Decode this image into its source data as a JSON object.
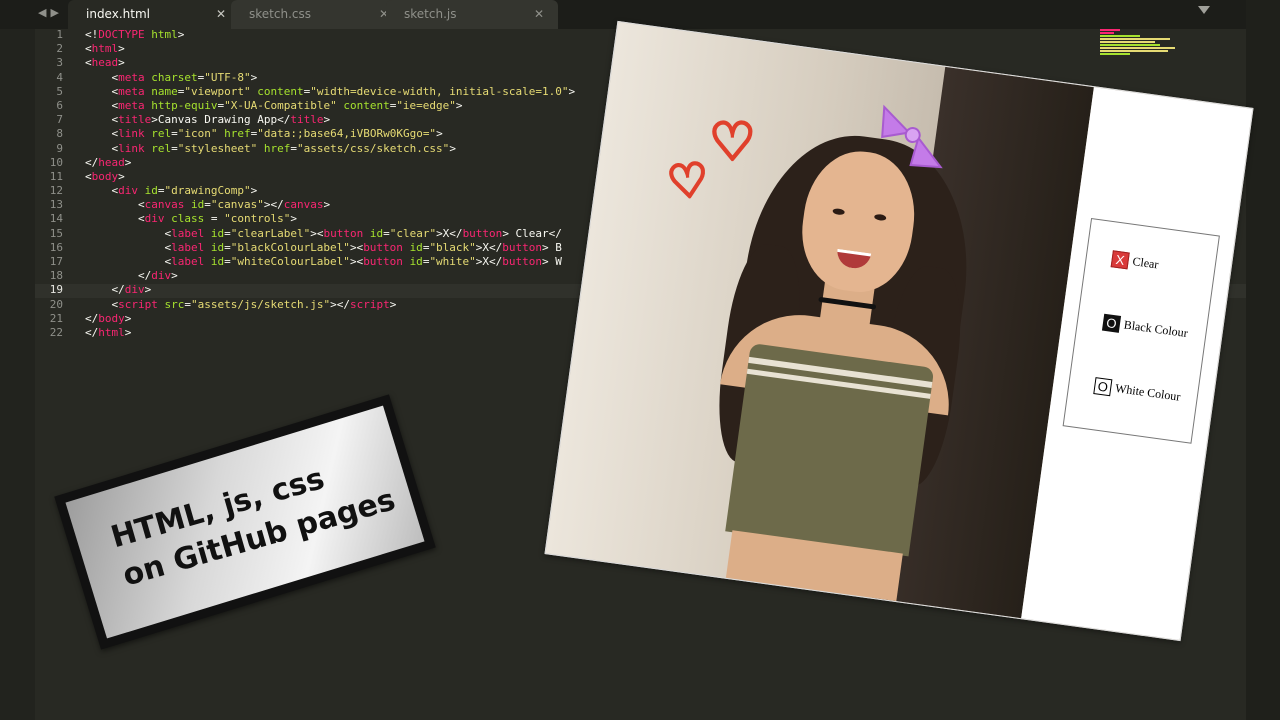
{
  "tabs": [
    {
      "label": "index.html",
      "active": true
    },
    {
      "label": "sketch.css",
      "active": false
    },
    {
      "label": "sketch.js",
      "active": false
    }
  ],
  "editor": {
    "current_line": 19,
    "line_numbers": [
      "1",
      "2",
      "3",
      "4",
      "5",
      "6",
      "7",
      "8",
      "9",
      "10",
      "11",
      "12",
      "13",
      "14",
      "15",
      "16",
      "17",
      "18",
      "19",
      "20",
      "21",
      "22"
    ],
    "lines": [
      {
        "parts": [
          {
            "t": "<!",
            "c": "p"
          },
          {
            "t": "DOCTYPE",
            "c": "tg"
          },
          {
            "t": " ",
            "c": "p"
          },
          {
            "t": "html",
            "c": "at"
          },
          {
            "t": ">",
            "c": "p"
          }
        ]
      },
      {
        "parts": [
          {
            "t": "<",
            "c": "p"
          },
          {
            "t": "html",
            "c": "tg"
          },
          {
            "t": ">",
            "c": "p"
          }
        ]
      },
      {
        "parts": [
          {
            "t": "<",
            "c": "p"
          },
          {
            "t": "head",
            "c": "tg"
          },
          {
            "t": ">",
            "c": "p"
          }
        ]
      },
      {
        "parts": [
          {
            "t": "    <",
            "c": "p"
          },
          {
            "t": "meta",
            "c": "tg"
          },
          {
            "t": " ",
            "c": "p"
          },
          {
            "t": "charset",
            "c": "at"
          },
          {
            "t": "=",
            "c": "p"
          },
          {
            "t": "\"UTF-8\"",
            "c": "st"
          },
          {
            "t": ">",
            "c": "p"
          }
        ]
      },
      {
        "parts": [
          {
            "t": "    <",
            "c": "p"
          },
          {
            "t": "meta",
            "c": "tg"
          },
          {
            "t": " ",
            "c": "p"
          },
          {
            "t": "name",
            "c": "at"
          },
          {
            "t": "=",
            "c": "p"
          },
          {
            "t": "\"viewport\"",
            "c": "st"
          },
          {
            "t": " ",
            "c": "p"
          },
          {
            "t": "content",
            "c": "at"
          },
          {
            "t": "=",
            "c": "p"
          },
          {
            "t": "\"width=device-width, initial-scale=1.0\"",
            "c": "st"
          },
          {
            "t": ">",
            "c": "p"
          }
        ]
      },
      {
        "parts": [
          {
            "t": "    <",
            "c": "p"
          },
          {
            "t": "meta",
            "c": "tg"
          },
          {
            "t": " ",
            "c": "p"
          },
          {
            "t": "http-equiv",
            "c": "at"
          },
          {
            "t": "=",
            "c": "p"
          },
          {
            "t": "\"X-UA-Compatible\"",
            "c": "st"
          },
          {
            "t": " ",
            "c": "p"
          },
          {
            "t": "content",
            "c": "at"
          },
          {
            "t": "=",
            "c": "p"
          },
          {
            "t": "\"ie=edge\"",
            "c": "st"
          },
          {
            "t": ">",
            "c": "p"
          }
        ]
      },
      {
        "parts": [
          {
            "t": "    <",
            "c": "p"
          },
          {
            "t": "title",
            "c": "tg"
          },
          {
            "t": ">Canvas Drawing App</",
            "c": "p"
          },
          {
            "t": "title",
            "c": "tg"
          },
          {
            "t": ">",
            "c": "p"
          }
        ]
      },
      {
        "parts": [
          {
            "t": "    <",
            "c": "p"
          },
          {
            "t": "link",
            "c": "tg"
          },
          {
            "t": " ",
            "c": "p"
          },
          {
            "t": "rel",
            "c": "at"
          },
          {
            "t": "=",
            "c": "p"
          },
          {
            "t": "\"icon\"",
            "c": "st"
          },
          {
            "t": " ",
            "c": "p"
          },
          {
            "t": "href",
            "c": "at"
          },
          {
            "t": "=",
            "c": "p"
          },
          {
            "t": "\"data:;base64,iVBORw0KGgo=\"",
            "c": "st"
          },
          {
            "t": ">",
            "c": "p"
          }
        ]
      },
      {
        "parts": [
          {
            "t": "    <",
            "c": "p"
          },
          {
            "t": "link",
            "c": "tg"
          },
          {
            "t": " ",
            "c": "p"
          },
          {
            "t": "rel",
            "c": "at"
          },
          {
            "t": "=",
            "c": "p"
          },
          {
            "t": "\"stylesheet\"",
            "c": "st"
          },
          {
            "t": " ",
            "c": "p"
          },
          {
            "t": "href",
            "c": "at"
          },
          {
            "t": "=",
            "c": "p"
          },
          {
            "t": "\"assets/css/sketch.css\"",
            "c": "st"
          },
          {
            "t": ">",
            "c": "p"
          }
        ]
      },
      {
        "parts": [
          {
            "t": "</",
            "c": "p"
          },
          {
            "t": "head",
            "c": "tg"
          },
          {
            "t": ">",
            "c": "p"
          }
        ]
      },
      {
        "parts": [
          {
            "t": "<",
            "c": "p"
          },
          {
            "t": "body",
            "c": "tg"
          },
          {
            "t": ">",
            "c": "p"
          }
        ]
      },
      {
        "parts": [
          {
            "t": "    <",
            "c": "p"
          },
          {
            "t": "div",
            "c": "tg"
          },
          {
            "t": " ",
            "c": "p"
          },
          {
            "t": "id",
            "c": "at"
          },
          {
            "t": "=",
            "c": "p"
          },
          {
            "t": "\"drawingComp\"",
            "c": "st"
          },
          {
            "t": ">",
            "c": "p"
          }
        ]
      },
      {
        "parts": [
          {
            "t": "        <",
            "c": "p"
          },
          {
            "t": "canvas",
            "c": "tg"
          },
          {
            "t": " ",
            "c": "p"
          },
          {
            "t": "id",
            "c": "at"
          },
          {
            "t": "=",
            "c": "p"
          },
          {
            "t": "\"canvas\"",
            "c": "st"
          },
          {
            "t": "></",
            "c": "p"
          },
          {
            "t": "canvas",
            "c": "tg"
          },
          {
            "t": ">",
            "c": "p"
          }
        ]
      },
      {
        "parts": [
          {
            "t": "        <",
            "c": "p"
          },
          {
            "t": "div",
            "c": "tg"
          },
          {
            "t": " ",
            "c": "p"
          },
          {
            "t": "class",
            "c": "at"
          },
          {
            "t": " = ",
            "c": "p"
          },
          {
            "t": "\"controls\"",
            "c": "st"
          },
          {
            "t": ">",
            "c": "p"
          }
        ]
      },
      {
        "parts": [
          {
            "t": "            <",
            "c": "p"
          },
          {
            "t": "label",
            "c": "tg"
          },
          {
            "t": " ",
            "c": "p"
          },
          {
            "t": "id",
            "c": "at"
          },
          {
            "t": "=",
            "c": "p"
          },
          {
            "t": "\"clearLabel\"",
            "c": "st"
          },
          {
            "t": "><",
            "c": "p"
          },
          {
            "t": "button",
            "c": "tg"
          },
          {
            "t": " ",
            "c": "p"
          },
          {
            "t": "id",
            "c": "at"
          },
          {
            "t": "=",
            "c": "p"
          },
          {
            "t": "\"clear\"",
            "c": "st"
          },
          {
            "t": ">X</",
            "c": "p"
          },
          {
            "t": "button",
            "c": "tg"
          },
          {
            "t": "> Clear</",
            "c": "p"
          }
        ]
      },
      {
        "parts": [
          {
            "t": "            <",
            "c": "p"
          },
          {
            "t": "label",
            "c": "tg"
          },
          {
            "t": " ",
            "c": "p"
          },
          {
            "t": "id",
            "c": "at"
          },
          {
            "t": "=",
            "c": "p"
          },
          {
            "t": "\"blackColourLabel\"",
            "c": "st"
          },
          {
            "t": "><",
            "c": "p"
          },
          {
            "t": "button",
            "c": "tg"
          },
          {
            "t": " ",
            "c": "p"
          },
          {
            "t": "id",
            "c": "at"
          },
          {
            "t": "=",
            "c": "p"
          },
          {
            "t": "\"black\"",
            "c": "st"
          },
          {
            "t": ">X</",
            "c": "p"
          },
          {
            "t": "button",
            "c": "tg"
          },
          {
            "t": "> B",
            "c": "p"
          }
        ]
      },
      {
        "parts": [
          {
            "t": "            <",
            "c": "p"
          },
          {
            "t": "label",
            "c": "tg"
          },
          {
            "t": " ",
            "c": "p"
          },
          {
            "t": "id",
            "c": "at"
          },
          {
            "t": "=",
            "c": "p"
          },
          {
            "t": "\"whiteColourLabel\"",
            "c": "st"
          },
          {
            "t": "><",
            "c": "p"
          },
          {
            "t": "button",
            "c": "tg"
          },
          {
            "t": " ",
            "c": "p"
          },
          {
            "t": "id",
            "c": "at"
          },
          {
            "t": "=",
            "c": "p"
          },
          {
            "t": "\"white\"",
            "c": "st"
          },
          {
            "t": ">X</",
            "c": "p"
          },
          {
            "t": "button",
            "c": "tg"
          },
          {
            "t": "> W",
            "c": "p"
          }
        ]
      },
      {
        "parts": [
          {
            "t": "        </",
            "c": "p"
          },
          {
            "t": "div",
            "c": "tg"
          },
          {
            "t": ">",
            "c": "p"
          }
        ]
      },
      {
        "parts": [
          {
            "t": "    </",
            "c": "p"
          },
          {
            "t": "div",
            "c": "tg"
          },
          {
            "t": ">",
            "c": "p"
          }
        ]
      },
      {
        "parts": [
          {
            "t": "    <",
            "c": "p"
          },
          {
            "t": "script",
            "c": "tg"
          },
          {
            "t": " ",
            "c": "p"
          },
          {
            "t": "src",
            "c": "at"
          },
          {
            "t": "=",
            "c": "p"
          },
          {
            "t": "\"assets/js/sketch.js\"",
            "c": "st"
          },
          {
            "t": "></",
            "c": "p"
          },
          {
            "t": "script",
            "c": "tg"
          },
          {
            "t": ">",
            "c": "p"
          }
        ]
      },
      {
        "parts": [
          {
            "t": "</",
            "c": "p"
          },
          {
            "t": "body",
            "c": "tg"
          },
          {
            "t": ">",
            "c": "p"
          }
        ]
      },
      {
        "parts": [
          {
            "t": "</",
            "c": "p"
          },
          {
            "t": "html",
            "c": "tg"
          },
          {
            "t": ">",
            "c": "p"
          }
        ]
      }
    ]
  },
  "photo": {
    "controls": {
      "clear": {
        "button": "X",
        "label": "Clear"
      },
      "black": {
        "button": "O",
        "label": "Black Colour"
      },
      "white": {
        "button": "O",
        "label": "White Colour"
      }
    }
  },
  "sticker": {
    "line1": "HTML, js, css",
    "line2": "on GitHub pages"
  },
  "colors": {
    "editor_bg": "#282923",
    "tag": "#f92672",
    "attribute": "#a6e22e",
    "string": "#e6db74",
    "heart": "#e0402c",
    "bow": "#c47be8",
    "clear_button": "#d93a3a"
  },
  "icons": [
    "back-arrow-icon",
    "forward-arrow-icon",
    "close-icon",
    "dropdown-icon",
    "heart-icon",
    "bow-icon"
  ]
}
